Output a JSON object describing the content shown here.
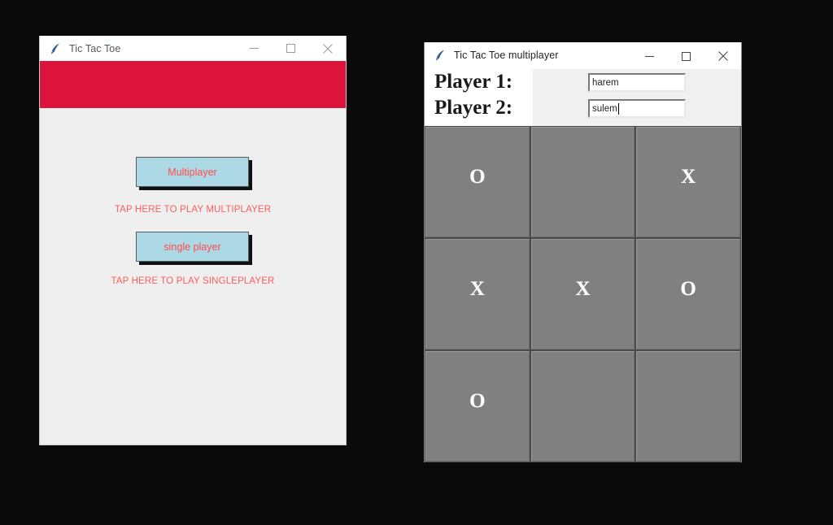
{
  "windows": {
    "single": {
      "title": "Tic Tac Toe",
      "icon": "python-feather-icon",
      "controls": {
        "minimize": "minimize-icon",
        "maximize": "maximize-icon",
        "close": "close-icon"
      },
      "banner_color": "#dc143c",
      "body_color": "#efefef",
      "buttons": [
        {
          "label": "Multiplayer",
          "caption": "TAP HERE TO PLAY MULTIPLAYER"
        },
        {
          "label": "single player",
          "caption": "TAP HERE TO PLAY SINGLEPLAYER"
        }
      ],
      "button_fill": "#add8e6",
      "button_text_color": "#ff4d4d",
      "caption_color": "#ff5c5c"
    },
    "multi": {
      "title": "Tic Tac Toe multiplayer",
      "icon": "python-feather-icon",
      "controls": {
        "minimize": "minimize-icon",
        "maximize": "maximize-icon",
        "close": "close-icon"
      },
      "players": [
        {
          "label": "Player 1:",
          "value": "harem",
          "placeholder": "",
          "focused": false
        },
        {
          "label": "Player 2:",
          "value": "sulem",
          "placeholder": "",
          "focused": true
        }
      ],
      "board": {
        "cell_color": "#808080",
        "mark_color": "#ffffff",
        "cells": [
          "O",
          "",
          "X",
          "X",
          "X",
          "O",
          "O",
          "",
          ""
        ]
      }
    }
  }
}
